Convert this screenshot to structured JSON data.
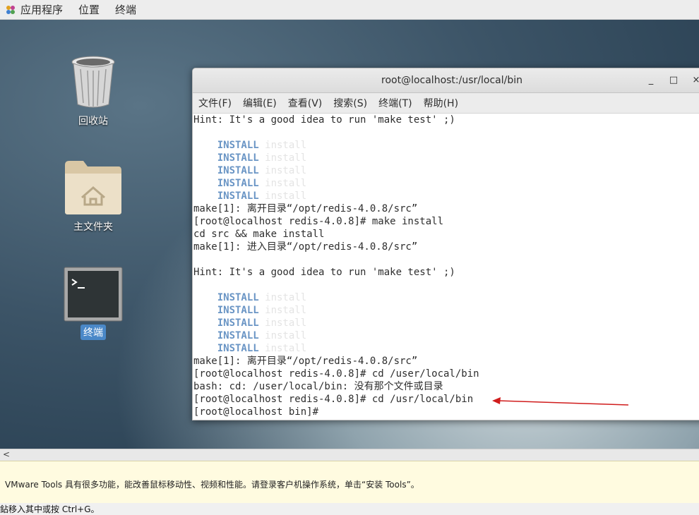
{
  "topbar": {
    "apps": "应用程序",
    "places": "位置",
    "terminal": "终端"
  },
  "desktop": {
    "trash": "回收站",
    "home": "主文件夹",
    "terminal": "终端"
  },
  "window": {
    "title": "root@localhost:/usr/local/bin",
    "minimize": "_",
    "maximize": "□",
    "close": "×",
    "menu": [
      "文件(F)",
      "编辑(E)",
      "查看(V)",
      "搜索(S)",
      "终端(T)",
      "帮助(H)"
    ]
  },
  "terminal_lines": [
    "Hint: It's a good idea to run 'make test' ;)",
    "",
    "INSTALL_ROW",
    "INSTALL_ROW",
    "INSTALL_ROW",
    "INSTALL_ROW",
    "INSTALL_ROW",
    "make[1]: 离开目录“/opt/redis-4.0.8/src”",
    "[root@localhost redis-4.0.8]# make install",
    "cd src && make install",
    "make[1]: 进入目录“/opt/redis-4.0.8/src”",
    "",
    "Hint: It's a good idea to run 'make test' ;)",
    "",
    "INSTALL_ROW",
    "INSTALL_ROW",
    "INSTALL_ROW",
    "INSTALL_ROW",
    "INSTALL_ROW",
    "make[1]: 离开目录“/opt/redis-4.0.8/src”",
    "[root@localhost redis-4.0.8]# cd /user/local/bin",
    "bash: cd: /user/local/bin: 没有那个文件或目录",
    "[root@localhost redis-4.0.8]# cd /usr/local/bin",
    "[root@localhost bin]# "
  ],
  "install": {
    "bold": "    INSTALL",
    "faint": " install"
  },
  "scroll_left": "<",
  "vmware_message": "VMware Tools 具有很多功能，能改善鼠标移动性、视频和性能。请登录客户机操作系统，单击“安装 Tools”。",
  "status_text": "鉆移入其中或按 Ctrl+G。",
  "colors": {
    "arrow": "#d01c1c",
    "install": "#6a95c5"
  }
}
